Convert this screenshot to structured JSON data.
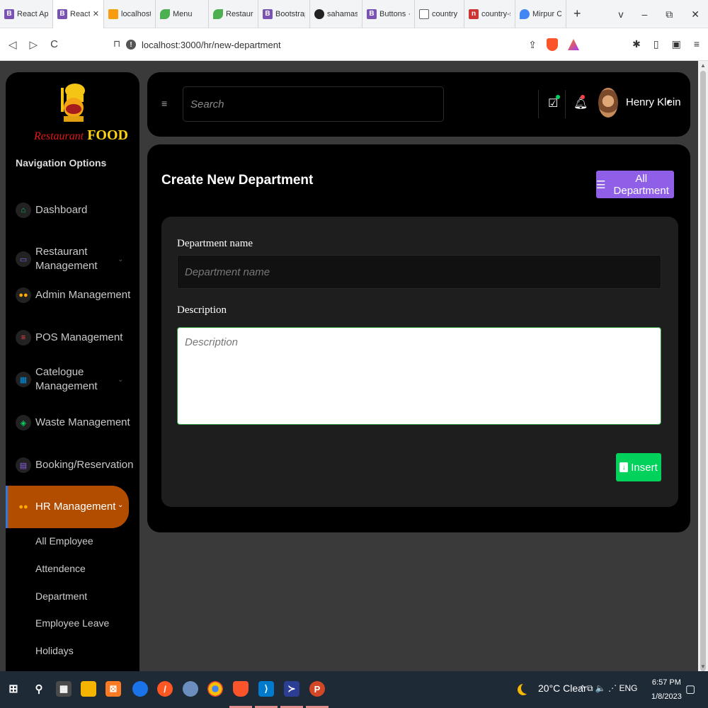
{
  "browser": {
    "tabs": [
      {
        "label": "React App",
        "icon": "B",
        "color": "#7952b3",
        "active": false
      },
      {
        "label": "React A",
        "icon": "B",
        "color": "#7952b3",
        "active": true
      },
      {
        "label": "localhost /",
        "icon": "pma",
        "color": "#f89c0e",
        "active": false
      },
      {
        "label": "Menu",
        "icon": "leaf",
        "color": "#4caf50",
        "active": false
      },
      {
        "label": "Restaurant",
        "icon": "leaf",
        "color": "#4caf50",
        "active": false
      },
      {
        "label": "Bootstrap",
        "icon": "B",
        "color": "#7952b3",
        "active": false
      },
      {
        "label": "sahamassi",
        "icon": "gh",
        "color": "#222222",
        "active": false
      },
      {
        "label": "Buttons · Bo",
        "icon": "B",
        "color": "#7952b3",
        "active": false
      },
      {
        "label": "country sta",
        "icon": "doc",
        "color": "#5f6368",
        "active": false
      },
      {
        "label": "country-sta",
        "icon": "n",
        "color": "#cc3534",
        "active": false
      },
      {
        "label": "Mirpur Club",
        "icon": "pin",
        "color": "#4285f4",
        "active": false
      }
    ],
    "new_tab": "+",
    "window_controls": [
      "v",
      "–",
      "⧉",
      "✕"
    ],
    "tab_close": "✕",
    "url": "localhost:3000/hr/new-department",
    "nav": {
      "back": "◁",
      "forward": "▷",
      "reload": "C",
      "bookmark": "⊓"
    },
    "brave_badge": "1"
  },
  "sidebar": {
    "brand_part1": "Restaurant",
    "brand_part2": "FOOD",
    "logo_text": "Restaurant FOOD",
    "nav_title": "Navigation Options",
    "items": [
      {
        "label": "Dashboard",
        "icon": "home-icon",
        "icon_color": "#00d25b",
        "has_chevron": false
      },
      {
        "label": "Restaurant Management",
        "icon": "laptop-icon",
        "icon_color": "#8f5fe8",
        "has_chevron": true
      },
      {
        "label": "Admin Management",
        "icon": "users-icon",
        "icon_color": "#ffab00",
        "has_chevron": true
      },
      {
        "label": "POS Management",
        "icon": "list-icon",
        "icon_color": "#fc424a",
        "has_chevron": true
      },
      {
        "label": "Catelogue Management",
        "icon": "grid-icon",
        "icon_color": "#0090e7",
        "has_chevron": true
      },
      {
        "label": "Waste Management",
        "icon": "shield-icon",
        "icon_color": "#00d25b",
        "has_chevron": true
      },
      {
        "label": "Booking/Reservation",
        "icon": "book-icon",
        "icon_color": "#8f5fe8",
        "has_chevron": true
      },
      {
        "label": "HR Management",
        "icon": "users-icon",
        "icon_color": "#ffab00",
        "has_chevron": true,
        "active": true
      }
    ],
    "chevron": "⌄",
    "sub_items": [
      "All Employee",
      "Attendence",
      "Department",
      "Employee Leave",
      "Holidays"
    ]
  },
  "header": {
    "menu_icon": "≡",
    "search_placeholder": "Search",
    "user_name": "Henry Klein",
    "user_caret": "▾"
  },
  "main": {
    "title": "Create New Department",
    "all_department_button": "All Department",
    "form": {
      "name_label": "Department name",
      "name_placeholder": "Department name",
      "name_value": "",
      "description_label": "Description",
      "description_placeholder": "Description",
      "description_value": "",
      "insert_button": "Insert"
    }
  },
  "taskbar": {
    "weather": "20°C  Clear",
    "tray": "^  ⧉  🔈  ⋰  ENG",
    "time": "6:57 PM",
    "date": "1/8/2023"
  },
  "colors": {
    "accent_purple": "#8f5fe8",
    "success_green": "#00d25b",
    "active_nav": "#b24d00",
    "panel_bg": "#000000",
    "card_bg": "#1e1e1e"
  }
}
